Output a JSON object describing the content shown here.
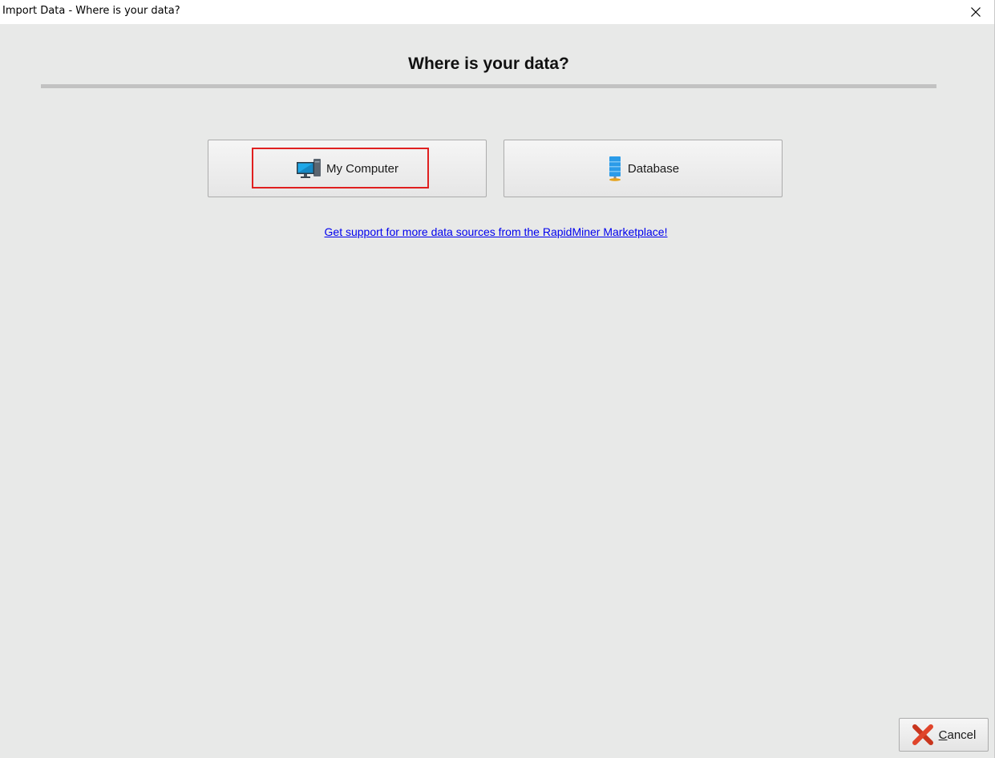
{
  "window": {
    "title": "Import Data - Where is your data?",
    "close_icon": "close-icon"
  },
  "main": {
    "heading": "Where is your data?",
    "sources": [
      {
        "label": "My Computer",
        "icon": "computer-icon",
        "highlighted": true
      },
      {
        "label": "Database",
        "icon": "database-icon",
        "highlighted": false
      }
    ],
    "marketplace_link": "Get support for more data sources from the RapidMiner Marketplace!"
  },
  "footer": {
    "cancel_label_mnemonic": "C",
    "cancel_label_rest": "ancel",
    "cancel_icon": "red-x-icon"
  },
  "colors": {
    "background": "#e8e9e8",
    "highlight": "#e02020",
    "link": "#0000ee"
  }
}
